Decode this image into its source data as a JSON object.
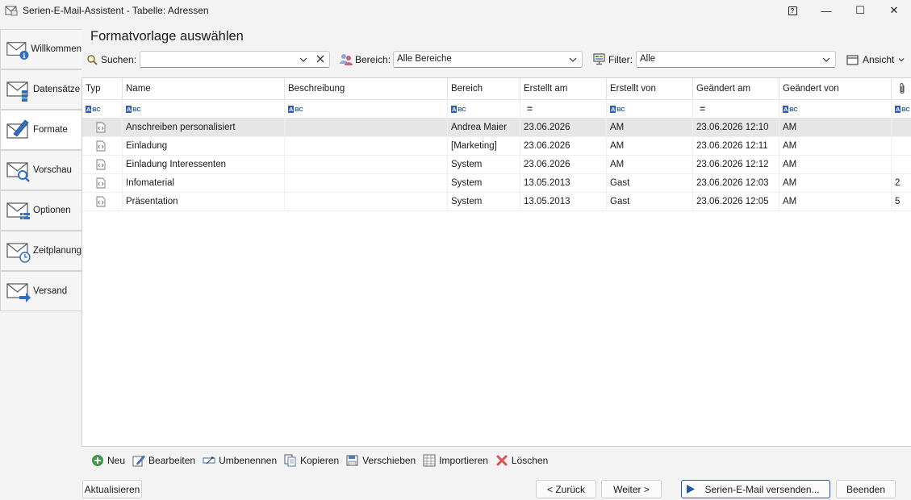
{
  "window": {
    "title": "Serien-E-Mail-Assistent - Tabelle: Adressen",
    "help_glyph": "?",
    "minimize_glyph": "—",
    "maximize_glyph": "☐",
    "close_glyph": "✕"
  },
  "nav": {
    "items": [
      {
        "label": "Willkommen",
        "icon": "mail-info-icon"
      },
      {
        "label": "Datensätze",
        "icon": "mail-records-icon"
      },
      {
        "label": "Formate",
        "icon": "mail-edit-icon",
        "active": true
      },
      {
        "label": "Vorschau",
        "icon": "mail-preview-icon"
      },
      {
        "label": "Optionen",
        "icon": "mail-options-icon"
      },
      {
        "label": "Zeitplanung",
        "icon": "mail-clock-icon"
      },
      {
        "label": "Versand",
        "icon": "mail-send-icon"
      }
    ]
  },
  "page": {
    "title": "Formatvorlage auswählen"
  },
  "toolbar": {
    "search_label": "Suchen:",
    "search_value": "",
    "bereich_label": "Bereich:",
    "bereich_value": "Alle Bereiche",
    "filter_label": "Filter:",
    "filter_value": "Alle",
    "ansicht_label": "Ansicht"
  },
  "table": {
    "columns": [
      "Typ",
      "Name",
      "Beschreibung",
      "Bereich",
      "Erstellt am",
      "Erstellt von",
      "Geändert am",
      "Geändert von",
      ""
    ],
    "filter_types": [
      "abc",
      "abc",
      "abc",
      "abc",
      "eq",
      "abc",
      "eq",
      "abc",
      "abc"
    ],
    "rows": [
      {
        "name": "Anschreiben personalisiert",
        "beschreibung": "",
        "bereich": "Andrea Maier",
        "erstellt_am": "23.06.2026",
        "erstellt_von": "AM",
        "geaendert_am": "23.06.2026 12:10",
        "geaendert_von": "AM",
        "anhaenge": "",
        "selected": true
      },
      {
        "name": "Einladung",
        "beschreibung": "",
        "bereich": "[Marketing]",
        "erstellt_am": "23.06.2026",
        "erstellt_von": "AM",
        "geaendert_am": "23.06.2026 12:11",
        "geaendert_von": "AM",
        "anhaenge": ""
      },
      {
        "name": "Einladung Interessenten",
        "beschreibung": "",
        "bereich": "System",
        "erstellt_am": "23.06.2026",
        "erstellt_von": "AM",
        "geaendert_am": "23.06.2026 12:12",
        "geaendert_von": "AM",
        "anhaenge": ""
      },
      {
        "name": "Infomaterial",
        "beschreibung": "",
        "bereich": "System",
        "erstellt_am": "13.05.2013",
        "erstellt_von": "Gast",
        "geaendert_am": "23.06.2026 12:03",
        "geaendert_von": "AM",
        "anhaenge": "2"
      },
      {
        "name": "Präsentation",
        "beschreibung": "",
        "bereich": "System",
        "erstellt_am": "13.05.2013",
        "erstellt_von": "Gast",
        "geaendert_am": "23.06.2026 12:05",
        "geaendert_von": "AM",
        "anhaenge": "5"
      }
    ]
  },
  "actions": {
    "neu": "Neu",
    "bearbeiten": "Bearbeiten",
    "umbenennen": "Umbenennen",
    "kopieren": "Kopieren",
    "verschieben": "Verschieben",
    "importieren": "Importieren",
    "loeschen": "Löschen"
  },
  "bottom": {
    "aktualisieren": "Aktualisieren",
    "zurueck": "< Zurück",
    "weiter": "Weiter >",
    "versenden": "Serien-E-Mail versenden...",
    "beenden": "Beenden"
  },
  "colors": {
    "accent": "#1e5aa8",
    "selected_row": "#e6e6e6",
    "delete_red": "#d9534f",
    "add_green": "#3a9a4a"
  }
}
